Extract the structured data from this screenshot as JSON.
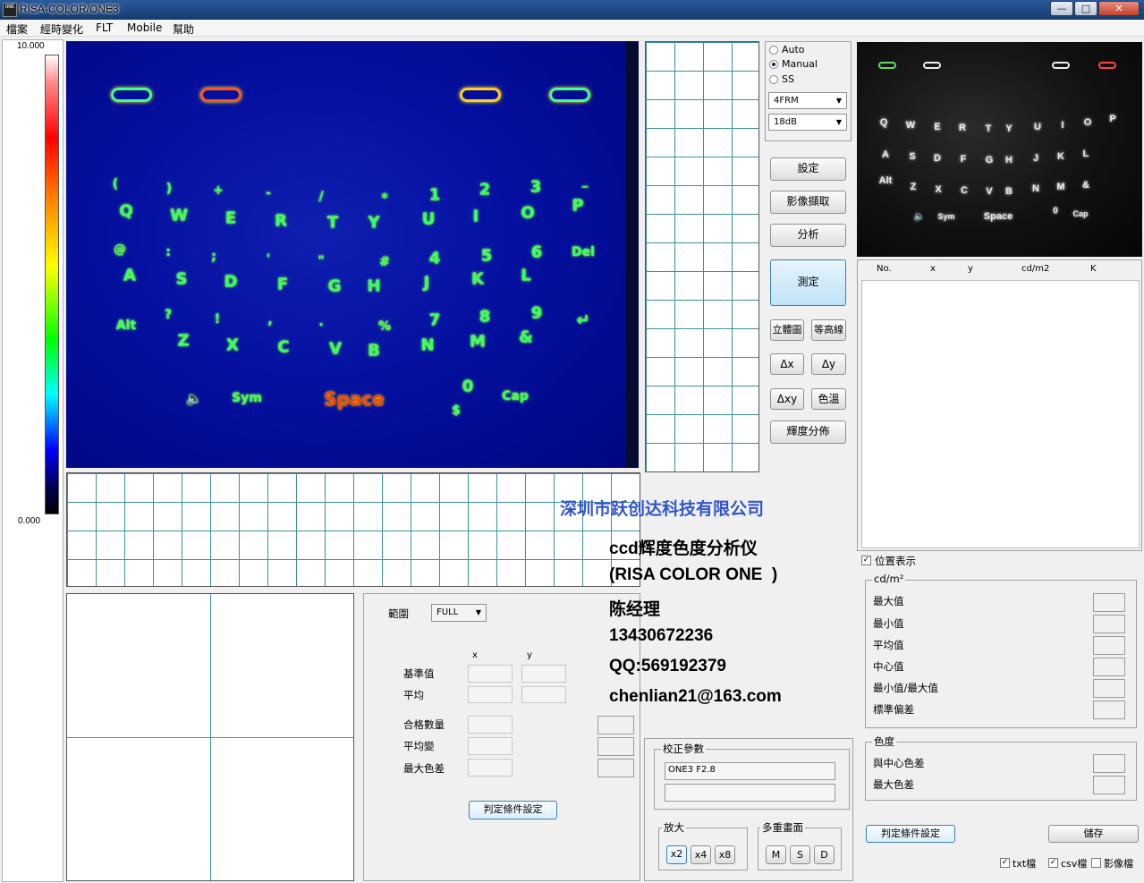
{
  "window": {
    "title": "RISA-COLOR/ONE3",
    "icon_text": "ONE",
    "controls": {
      "minimize": "—",
      "maximize": "□",
      "close": "✕"
    }
  },
  "menu": [
    "檔案",
    "經時變化",
    "FLT",
    "Mobile",
    "幫助"
  ],
  "scale": {
    "max": "10.000",
    "min": "0.000"
  },
  "keyboard_image": {
    "top_row": [
      "o",
      "=",
      "↵",
      "o"
    ],
    "row1_symbols": [
      "(",
      ")",
      "+",
      "-",
      "/",
      "*",
      "1",
      "2",
      "3",
      "_"
    ],
    "row1_letters": [
      "Q",
      "W",
      "E",
      "R",
      "T",
      "Y",
      "U",
      "I",
      "O",
      "P"
    ],
    "row2_symbols": [
      "@",
      ":",
      ";",
      "'",
      "\"",
      "#",
      "4",
      "5",
      "6",
      "Del"
    ],
    "row2_letters": [
      "A",
      "S",
      "D",
      "F",
      "G",
      "H",
      "J",
      "K",
      "L"
    ],
    "row3_symbols": [
      "?",
      "!",
      ",",
      ".",
      "%",
      "7",
      "8",
      "9"
    ],
    "row3_letters": [
      "Alt",
      "Z",
      "X",
      "C",
      "V",
      "B",
      "N",
      "M",
      "&",
      "↵"
    ],
    "row4": [
      "🔈",
      "Sym",
      "Space",
      "0",
      "$",
      "Cap"
    ]
  },
  "mode": {
    "options": [
      "Auto",
      "Manual",
      "SS"
    ],
    "selected": "Manual",
    "frame_select": "4FRM",
    "gain_select": "18dB"
  },
  "buttons": {
    "settings": "設定",
    "capture": "影像擷取",
    "analyze": "分析",
    "measure": "測定",
    "stereo": "立體圖",
    "contour": "等高線",
    "dx": "Δx",
    "dy": "Δy",
    "dxy": "Δxy",
    "color_temp": "色溫",
    "brightness_dist": "輝度分佈"
  },
  "table": {
    "headers": [
      "No.",
      "x",
      "y",
      "cd/m2",
      "K"
    ]
  },
  "position_display": {
    "label": "位置表示",
    "checked": true
  },
  "stats": {
    "unit": "cd/m²",
    "rows": [
      "最大值",
      "最小值",
      "平均值",
      "中心值",
      "最小值/最大值",
      "標準偏差"
    ],
    "color_label": "色度",
    "color_rows": [
      "與中心色差",
      "最大色差"
    ]
  },
  "right_bottom": {
    "judge_button": "判定條件設定",
    "save_button": "儲存",
    "checks": [
      {
        "label": "txt檔",
        "checked": true
      },
      {
        "label": "csv檔",
        "checked": true
      },
      {
        "label": "影像檔",
        "checked": false
      }
    ]
  },
  "range_panel": {
    "range_label": "範圍",
    "range_value": "FULL",
    "col_x": "x",
    "col_y": "y",
    "rows_xy": [
      "基準值",
      "平均"
    ],
    "rows_single": [
      "合格數量",
      "平均變",
      "最大色差"
    ],
    "judge_button": "判定條件設定"
  },
  "calibration": {
    "label": "校正參數",
    "value": "ONE3 F2.8",
    "value2": ""
  },
  "zoom": {
    "label": "放大",
    "options": [
      "x2",
      "x4",
      "x8"
    ],
    "selected": "x2"
  },
  "multiscreen": {
    "label": "多重畫面",
    "options": [
      "M",
      "S",
      "D"
    ]
  },
  "overlay": {
    "company": "深圳市跃创达科技有限公司",
    "product": "ccd辉度色度分析仪",
    "model": "(RISA COLOR ONE  )",
    "contact": "陈经理",
    "phone": "13430672236",
    "qq": "QQ:569192379",
    "email": "chenlian21@163.com"
  },
  "colors": {
    "accent": "#3c7fb1",
    "grid": "#3d8fa0",
    "title_bar": "#1e4a85",
    "heatmap_bg": "#0510a0"
  }
}
